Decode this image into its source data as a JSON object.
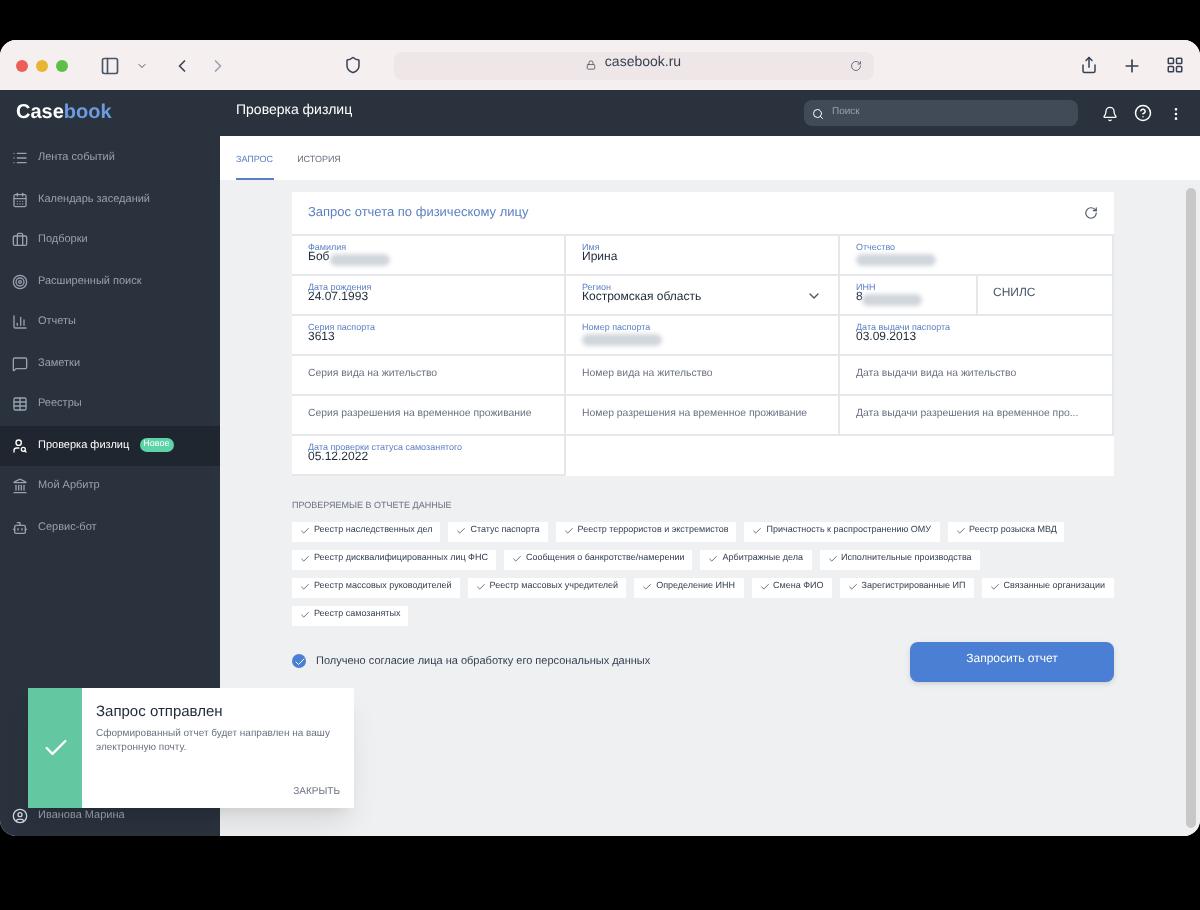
{
  "browser": {
    "url": "casebook.ru"
  },
  "sidebar": {
    "logo_a": "Case",
    "logo_b": "book",
    "items": [
      {
        "label": "Лента событий",
        "selected": false
      },
      {
        "label": "Календарь заседаний",
        "selected": false
      },
      {
        "label": "Подборки",
        "selected": false
      },
      {
        "label": "Расширенный поиск",
        "selected": false
      },
      {
        "label": "Отчеты",
        "selected": false
      },
      {
        "label": "Заметки",
        "selected": false
      },
      {
        "label": "Реестры",
        "selected": false
      },
      {
        "label": "Проверка физлиц",
        "selected": true,
        "badge": "Новое"
      },
      {
        "label": "Мой Арбитр",
        "selected": false
      },
      {
        "label": "Сервис-бот",
        "selected": false
      }
    ],
    "user": "Иванова Марина"
  },
  "header": {
    "title": "Проверка физлиц",
    "search": {
      "placeholder": "Поиск"
    }
  },
  "tabs": [
    {
      "label": "ЗАПРОС",
      "selected": true
    },
    {
      "label": "ИСТОРИЯ",
      "selected": false
    }
  ],
  "form": {
    "title": "Запрос отчета по физическому лицу",
    "rows": [
      [
        {
          "kind": "field",
          "label": "Фамилия",
          "value": "Боб",
          "redacted": true
        },
        {
          "kind": "field",
          "label": "Имя",
          "value": "Ирина",
          "redacted": false
        },
        {
          "kind": "field",
          "label": "Отчество",
          "redacted": true
        }
      ],
      [
        {
          "kind": "field",
          "label": "Дата рождения",
          "value": "24.07.1993",
          "redacted": false
        },
        {
          "kind": "select",
          "label": "Регион",
          "value": "Костромская область"
        },
        {
          "kind": "field",
          "label": "ИНН",
          "value": "8",
          "redacted": true
        },
        {
          "kind": "button",
          "label": "СНИЛС"
        }
      ],
      [
        {
          "kind": "field",
          "label": "Серия паспорта",
          "value": "3613",
          "redacted": false
        },
        {
          "kind": "field",
          "label": "Номер паспорта",
          "redacted": true
        },
        {
          "kind": "field",
          "label": "Дата выдачи паспорта",
          "value": "03.09.2013",
          "redacted": false
        }
      ],
      [
        {
          "kind": "empty",
          "placeholder": "Серия вида на жительство"
        },
        {
          "kind": "empty",
          "placeholder": "Номер вида на жительство"
        },
        {
          "kind": "empty",
          "placeholder": "Дата выдачи вида на жительство"
        }
      ],
      [
        {
          "kind": "empty",
          "placeholder": "Серия разрешения на временное проживание"
        },
        {
          "kind": "empty",
          "placeholder": "Номер разрешения на временное проживание"
        },
        {
          "kind": "empty",
          "placeholder": "Дата выдачи разрешения на временное про..."
        }
      ],
      [
        {
          "kind": "field",
          "label": "Дата проверки статуса самозанятого",
          "value": "05.12.2022",
          "redacted": false
        }
      ]
    ]
  },
  "checks": {
    "title": "ПРОВЕРЯЕМЫЕ В ОТЧЕТЕ ДАННЫЕ",
    "items": [
      {
        "label": "Реестр наследственных дел",
        "checked": true
      },
      {
        "label": "Статус паспорта",
        "checked": true
      },
      {
        "label": "Реестр террористов и экстремистов",
        "checked": true
      },
      {
        "label": "Причастность к распространению ОМУ",
        "checked": true
      },
      {
        "label": "Реестр розыска МВД",
        "checked": true
      },
      {
        "label": "Реестр дисквалифицированных лиц ФНС",
        "checked": true
      },
      {
        "label": "Сообщения о банкротстве/намерении",
        "checked": true
      },
      {
        "label": "Арбитражные дела",
        "checked": true
      },
      {
        "label": "Исполнительные производства",
        "checked": true
      },
      {
        "label": "Реестр массовых руководителей",
        "checked": true
      },
      {
        "label": "Реестр массовых учредителей",
        "checked": true
      },
      {
        "label": "Определение ИНН",
        "checked": true
      },
      {
        "label": "Смена ФИО",
        "checked": true
      },
      {
        "label": "Зарегистрированные ИП",
        "checked": true
      },
      {
        "label": "Связанные организации",
        "checked": true
      },
      {
        "label": "Реестр самозанятых",
        "checked": true
      }
    ]
  },
  "consent": {
    "label": "Получено согласие лица на обработку его персональных данных",
    "checked": true
  },
  "submit": "Запросить отчет",
  "toast": {
    "title": "Запрос отправлен",
    "message": "Сформированный отчет будет направлен на вашу электронную почту.",
    "close": "ЗАКРЫТЬ"
  }
}
